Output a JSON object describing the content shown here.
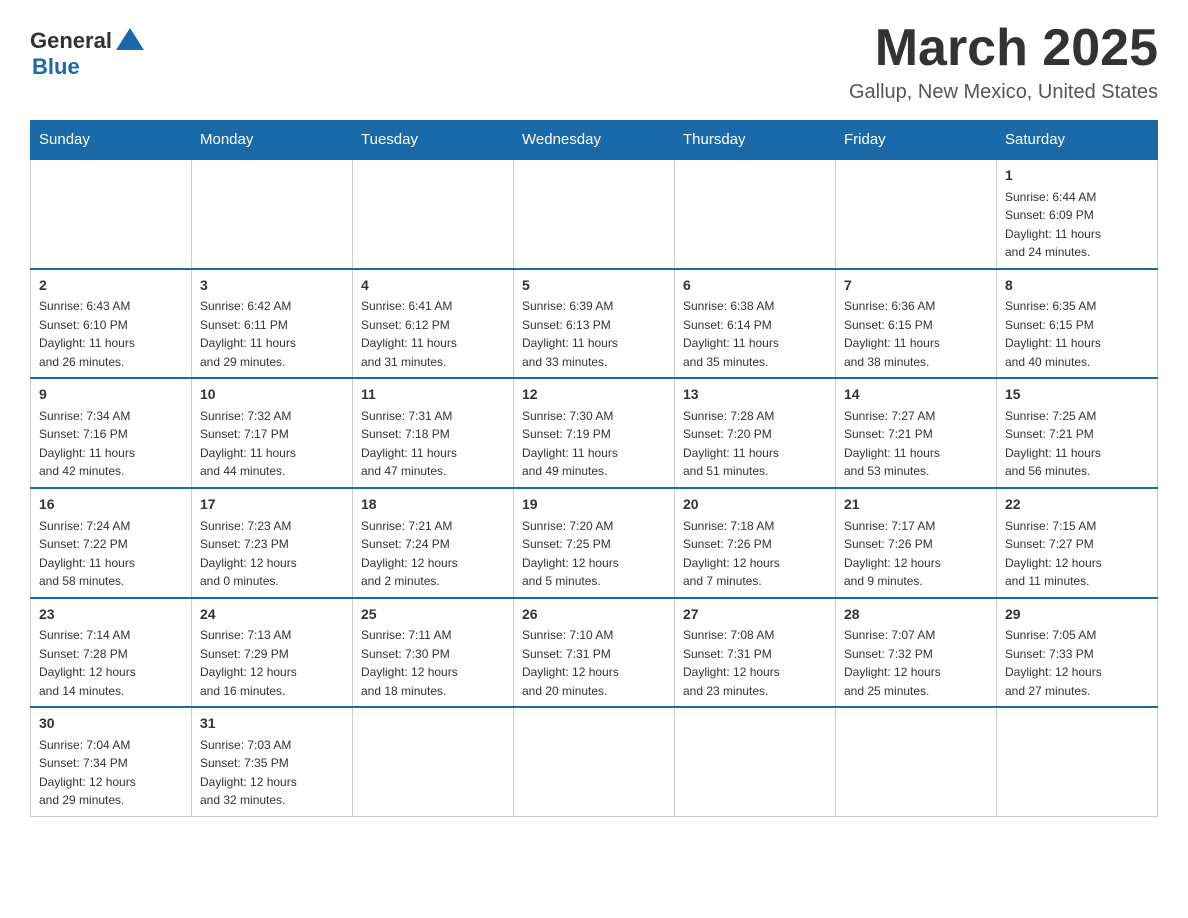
{
  "header": {
    "logo_general": "General",
    "logo_blue": "Blue",
    "month_title": "March 2025",
    "location": "Gallup, New Mexico, United States"
  },
  "weekdays": [
    "Sunday",
    "Monday",
    "Tuesday",
    "Wednesday",
    "Thursday",
    "Friday",
    "Saturday"
  ],
  "weeks": [
    [
      {
        "day": "",
        "info": ""
      },
      {
        "day": "",
        "info": ""
      },
      {
        "day": "",
        "info": ""
      },
      {
        "day": "",
        "info": ""
      },
      {
        "day": "",
        "info": ""
      },
      {
        "day": "",
        "info": ""
      },
      {
        "day": "1",
        "info": "Sunrise: 6:44 AM\nSunset: 6:09 PM\nDaylight: 11 hours\nand 24 minutes."
      }
    ],
    [
      {
        "day": "2",
        "info": "Sunrise: 6:43 AM\nSunset: 6:10 PM\nDaylight: 11 hours\nand 26 minutes."
      },
      {
        "day": "3",
        "info": "Sunrise: 6:42 AM\nSunset: 6:11 PM\nDaylight: 11 hours\nand 29 minutes."
      },
      {
        "day": "4",
        "info": "Sunrise: 6:41 AM\nSunset: 6:12 PM\nDaylight: 11 hours\nand 31 minutes."
      },
      {
        "day": "5",
        "info": "Sunrise: 6:39 AM\nSunset: 6:13 PM\nDaylight: 11 hours\nand 33 minutes."
      },
      {
        "day": "6",
        "info": "Sunrise: 6:38 AM\nSunset: 6:14 PM\nDaylight: 11 hours\nand 35 minutes."
      },
      {
        "day": "7",
        "info": "Sunrise: 6:36 AM\nSunset: 6:15 PM\nDaylight: 11 hours\nand 38 minutes."
      },
      {
        "day": "8",
        "info": "Sunrise: 6:35 AM\nSunset: 6:15 PM\nDaylight: 11 hours\nand 40 minutes."
      }
    ],
    [
      {
        "day": "9",
        "info": "Sunrise: 7:34 AM\nSunset: 7:16 PM\nDaylight: 11 hours\nand 42 minutes."
      },
      {
        "day": "10",
        "info": "Sunrise: 7:32 AM\nSunset: 7:17 PM\nDaylight: 11 hours\nand 44 minutes."
      },
      {
        "day": "11",
        "info": "Sunrise: 7:31 AM\nSunset: 7:18 PM\nDaylight: 11 hours\nand 47 minutes."
      },
      {
        "day": "12",
        "info": "Sunrise: 7:30 AM\nSunset: 7:19 PM\nDaylight: 11 hours\nand 49 minutes."
      },
      {
        "day": "13",
        "info": "Sunrise: 7:28 AM\nSunset: 7:20 PM\nDaylight: 11 hours\nand 51 minutes."
      },
      {
        "day": "14",
        "info": "Sunrise: 7:27 AM\nSunset: 7:21 PM\nDaylight: 11 hours\nand 53 minutes."
      },
      {
        "day": "15",
        "info": "Sunrise: 7:25 AM\nSunset: 7:21 PM\nDaylight: 11 hours\nand 56 minutes."
      }
    ],
    [
      {
        "day": "16",
        "info": "Sunrise: 7:24 AM\nSunset: 7:22 PM\nDaylight: 11 hours\nand 58 minutes."
      },
      {
        "day": "17",
        "info": "Sunrise: 7:23 AM\nSunset: 7:23 PM\nDaylight: 12 hours\nand 0 minutes."
      },
      {
        "day": "18",
        "info": "Sunrise: 7:21 AM\nSunset: 7:24 PM\nDaylight: 12 hours\nand 2 minutes."
      },
      {
        "day": "19",
        "info": "Sunrise: 7:20 AM\nSunset: 7:25 PM\nDaylight: 12 hours\nand 5 minutes."
      },
      {
        "day": "20",
        "info": "Sunrise: 7:18 AM\nSunset: 7:26 PM\nDaylight: 12 hours\nand 7 minutes."
      },
      {
        "day": "21",
        "info": "Sunrise: 7:17 AM\nSunset: 7:26 PM\nDaylight: 12 hours\nand 9 minutes."
      },
      {
        "day": "22",
        "info": "Sunrise: 7:15 AM\nSunset: 7:27 PM\nDaylight: 12 hours\nand 11 minutes."
      }
    ],
    [
      {
        "day": "23",
        "info": "Sunrise: 7:14 AM\nSunset: 7:28 PM\nDaylight: 12 hours\nand 14 minutes."
      },
      {
        "day": "24",
        "info": "Sunrise: 7:13 AM\nSunset: 7:29 PM\nDaylight: 12 hours\nand 16 minutes."
      },
      {
        "day": "25",
        "info": "Sunrise: 7:11 AM\nSunset: 7:30 PM\nDaylight: 12 hours\nand 18 minutes."
      },
      {
        "day": "26",
        "info": "Sunrise: 7:10 AM\nSunset: 7:31 PM\nDaylight: 12 hours\nand 20 minutes."
      },
      {
        "day": "27",
        "info": "Sunrise: 7:08 AM\nSunset: 7:31 PM\nDaylight: 12 hours\nand 23 minutes."
      },
      {
        "day": "28",
        "info": "Sunrise: 7:07 AM\nSunset: 7:32 PM\nDaylight: 12 hours\nand 25 minutes."
      },
      {
        "day": "29",
        "info": "Sunrise: 7:05 AM\nSunset: 7:33 PM\nDaylight: 12 hours\nand 27 minutes."
      }
    ],
    [
      {
        "day": "30",
        "info": "Sunrise: 7:04 AM\nSunset: 7:34 PM\nDaylight: 12 hours\nand 29 minutes."
      },
      {
        "day": "31",
        "info": "Sunrise: 7:03 AM\nSunset: 7:35 PM\nDaylight: 12 hours\nand 32 minutes."
      },
      {
        "day": "",
        "info": ""
      },
      {
        "day": "",
        "info": ""
      },
      {
        "day": "",
        "info": ""
      },
      {
        "day": "",
        "info": ""
      },
      {
        "day": "",
        "info": ""
      }
    ]
  ]
}
